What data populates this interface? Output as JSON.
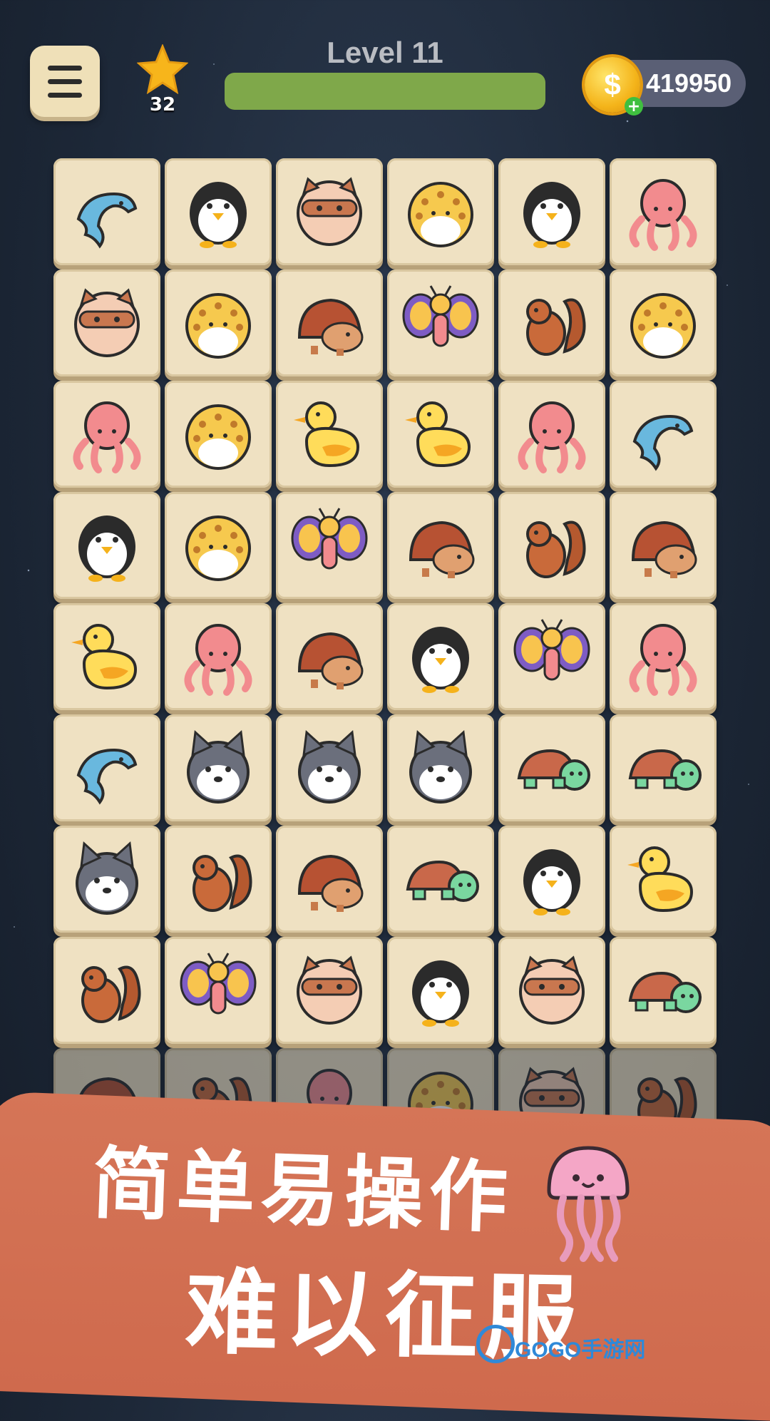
{
  "header": {
    "level_title": "Level 11",
    "level_progress": 1.0,
    "stars": "32",
    "coins": "419950",
    "coin_symbol": "$",
    "coin_add": "+"
  },
  "board": {
    "columns": 6,
    "rows": [
      [
        "dolphin",
        "penguin",
        "raccoon",
        "leopard",
        "penguin",
        "octopus"
      ],
      [
        "raccoon",
        "leopard",
        "hedgehog",
        "butterfly",
        "squirrel",
        "leopard"
      ],
      [
        "octopus",
        "leopard",
        "duck",
        "duck",
        "octopus",
        "dolphin"
      ],
      [
        "penguin",
        "leopard",
        "butterfly",
        "hedgehog",
        "squirrel",
        "hedgehog"
      ],
      [
        "duck",
        "octopus",
        "hedgehog",
        "penguin",
        "butterfly",
        "octopus"
      ],
      [
        "dolphin",
        "wolf",
        "wolf",
        "wolf",
        "turtle",
        "turtle"
      ],
      [
        "wolf",
        "squirrel",
        "hedgehog",
        "turtle",
        "penguin",
        "duck"
      ],
      [
        "squirrel",
        "butterfly",
        "raccoon",
        "penguin",
        "raccoon",
        "turtle"
      ],
      [
        "hedgehog",
        "squirrel",
        "octopus",
        "leopard",
        "raccoon",
        "squirrel"
      ]
    ]
  },
  "promo": {
    "line1": "简单易操作",
    "line2": "难以征服",
    "mascot": "jellyfish-icon"
  },
  "watermark": "GOGO手游网",
  "colors": {
    "tile": "#efe1c2",
    "progress": "#7fa84a",
    "banner": "#d57557"
  }
}
